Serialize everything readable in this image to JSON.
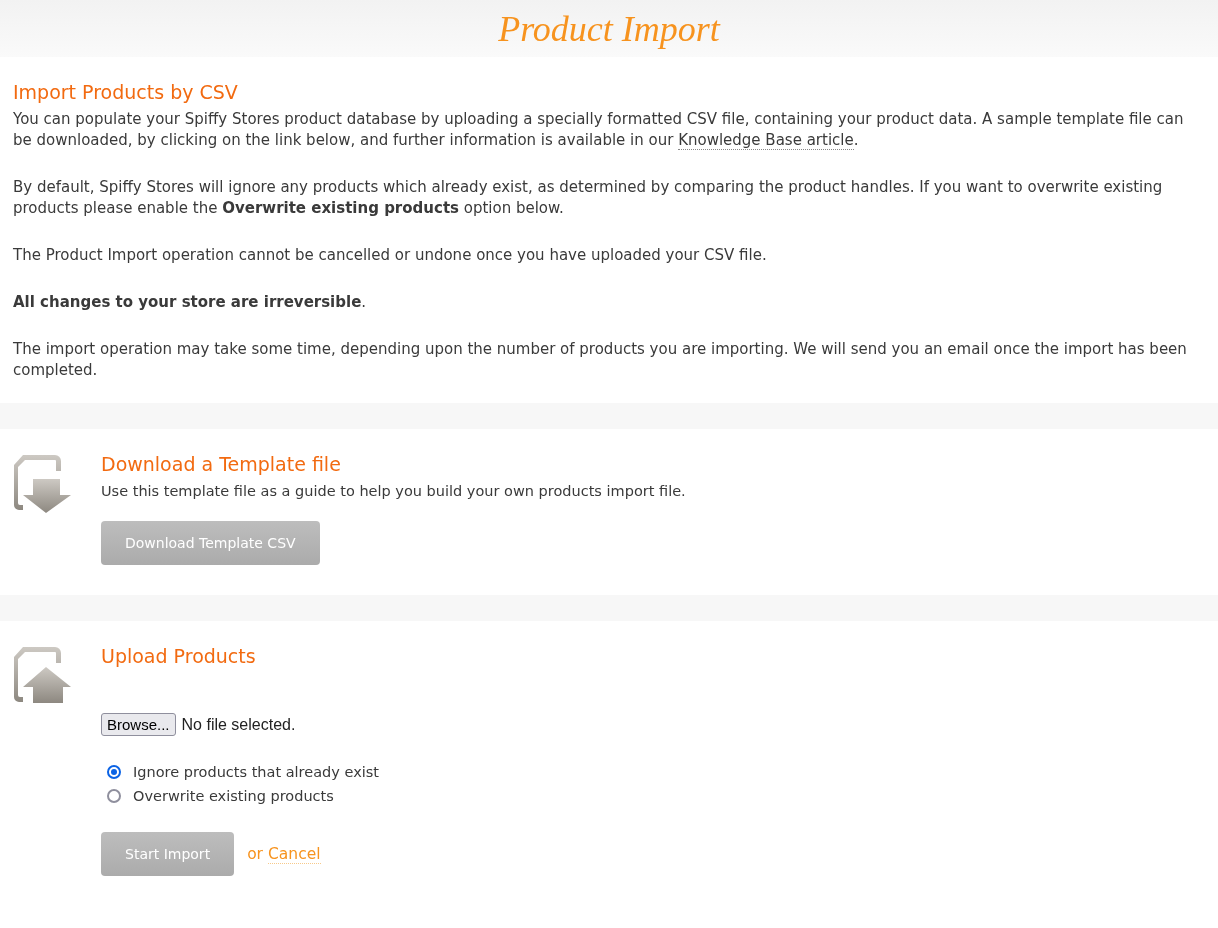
{
  "header": {
    "title": "Product Import"
  },
  "intro": {
    "heading": "Import Products by CSV",
    "paragraphs": [
      {
        "text": "You can populate your Spiffy Stores product database by uploading a specially formatted CSV file, containing your product data. A sample template file can be downloaded, by clicking on the link below, and further information is available in our ",
        "link": "Knowledge Base article",
        "after": "."
      },
      {
        "text": "By default, Spiffy Stores will ignore any products which already exist, as determined by comparing the product handles. If you want to overwrite existing products please enable the **Overwrite existing products** option below."
      },
      {
        "text": "The Product Import operation cannot be cancelled or undone once you have uploaded your CSV file."
      },
      {
        "text": "**All changes to your store are irreversible**."
      },
      {
        "text": "The import operation may take some time, depending upon the number of products you are importing. We will send you an email once the import has been completed."
      }
    ]
  },
  "download": {
    "heading": "Download a Template file",
    "description": "Use this template file as a guide to help you build your own products import file.",
    "button": "Download Template CSV"
  },
  "upload": {
    "heading": "Upload Products",
    "browse_button": "Browse...",
    "file_status": "No file selected.",
    "options": [
      {
        "label": "Ignore products that already exist",
        "selected": true
      },
      {
        "label": "Overwrite existing products",
        "selected": false
      }
    ],
    "submit_button": "Start Import",
    "or_text": "or",
    "cancel_link": "Cancel"
  }
}
